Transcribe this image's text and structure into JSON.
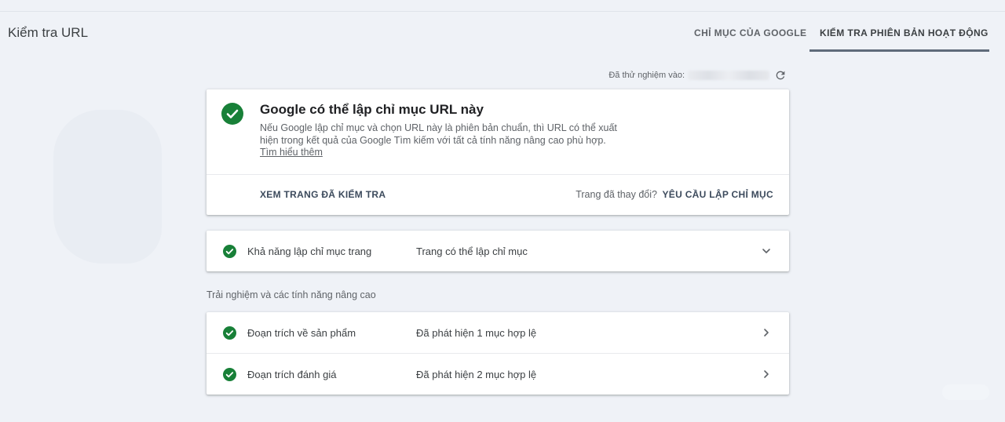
{
  "header": {
    "title": "Kiểm tra URL",
    "tabs": [
      {
        "label": "CHỈ MỤC CỦA GOOGLE",
        "active": false
      },
      {
        "label": "KIỂM TRA PHIÊN BẢN HOẠT ĐỘNG",
        "active": true
      }
    ]
  },
  "test_info": {
    "label": "Đã thử nghiệm vào:"
  },
  "status_card": {
    "title": "Google có thể lập chỉ mục URL này",
    "description": "Nếu Google lập chỉ mục và chọn URL này là phiên bản chuẩn, thì URL có thể xuất hiện trong kết quả của Google Tìm kiếm với tất cả tính năng nâng cao phù hợp.",
    "learn_more": "Tìm hiểu thêm",
    "view_button": "XEM TRANG ĐÃ KIỂM TRA",
    "changed_question": "Trang đã thay đổi?",
    "request_button": "YÊU CẦU LẬP CHỈ MỤC"
  },
  "indexability": {
    "label": "Khả năng lập chỉ mục trang",
    "value": "Trang có thể lập chỉ mục"
  },
  "enhancements": {
    "heading": "Trải nghiệm và các tính năng nâng cao",
    "items": [
      {
        "label": "Đoạn trích về sản phẩm",
        "value": "Đã phát hiện 1 mục hợp lệ"
      },
      {
        "label": "Đoạn trích đánh giá",
        "value": "Đã phát hiện 2 mục hợp lệ"
      }
    ]
  },
  "colors": {
    "success_green": "#188038",
    "background": "#eff2f7",
    "accent_text": "#3c4a5c"
  }
}
